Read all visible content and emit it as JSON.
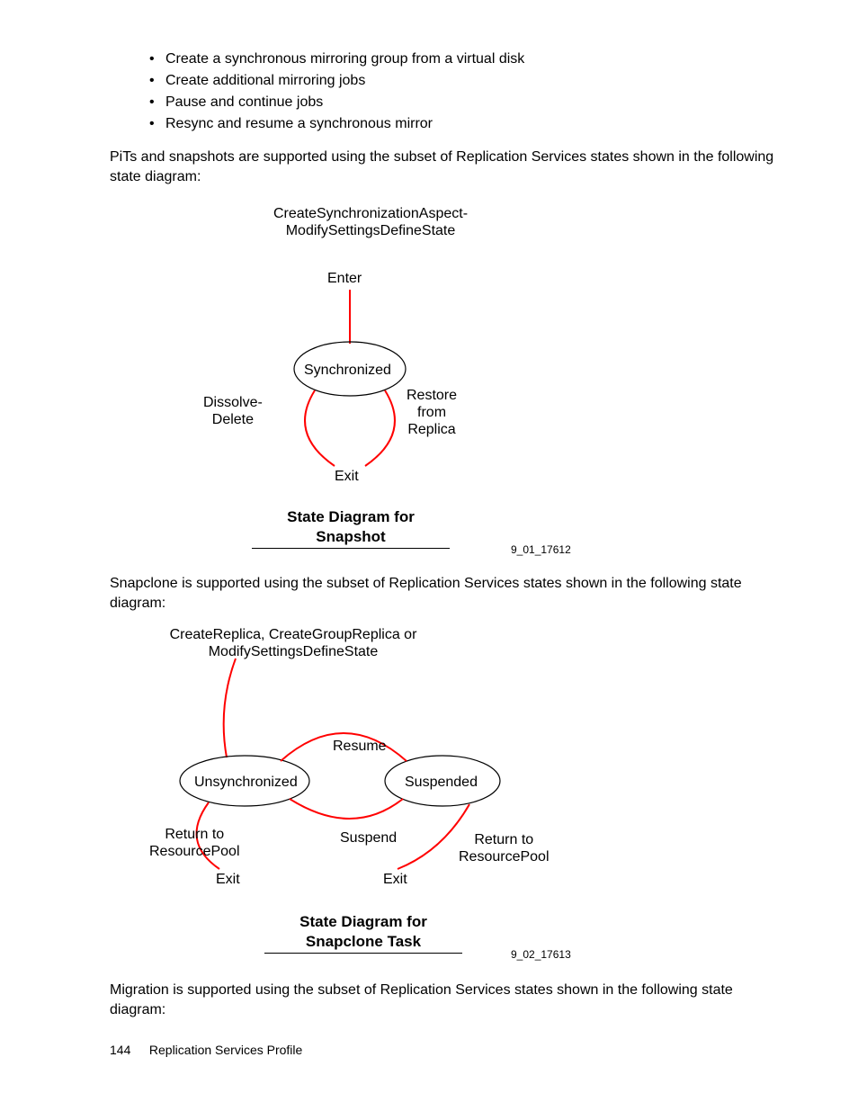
{
  "bullets": [
    "Create a synchronous mirroring group from a virtual disk",
    "Create additional mirroring jobs",
    "Pause and continue jobs",
    "Resync and resume a synchronous mirror"
  ],
  "para1": "PiTs and snapshots are supported using the subset of Replication Services states shown in the following state diagram:",
  "diagram1": {
    "headline": "CreateSynchronizationAspect-\nModifySettingsDefineState",
    "enter": "Enter",
    "state": "Synchronized",
    "left": "Dissolve-\nDelete",
    "right": "Restore\nfrom\nReplica",
    "exit": "Exit",
    "title": "State Diagram for\nSnapshot",
    "figid": "9_01_17612"
  },
  "para2": "Snapclone is supported using the subset of Replication Services states shown in the following state diagram:",
  "diagram2": {
    "headline": "CreateReplica, CreateGroupReplica or\nModifySettingsDefineState",
    "state_left": "Unsynchronized",
    "state_right": "Suspended",
    "resume": "Resume",
    "suspend": "Suspend",
    "return_left": "Return to\nResourcePool",
    "return_right": "Return to\nResourcePool",
    "exit_left": "Exit",
    "exit_right": "Exit",
    "title": "State Diagram for\nSnapclone Task",
    "figid": "9_02_17613"
  },
  "para3": "Migration is supported using the subset of Replication Services states shown in the following state diagram:",
  "footer": {
    "page": "144",
    "section": "Replication Services Profile"
  }
}
